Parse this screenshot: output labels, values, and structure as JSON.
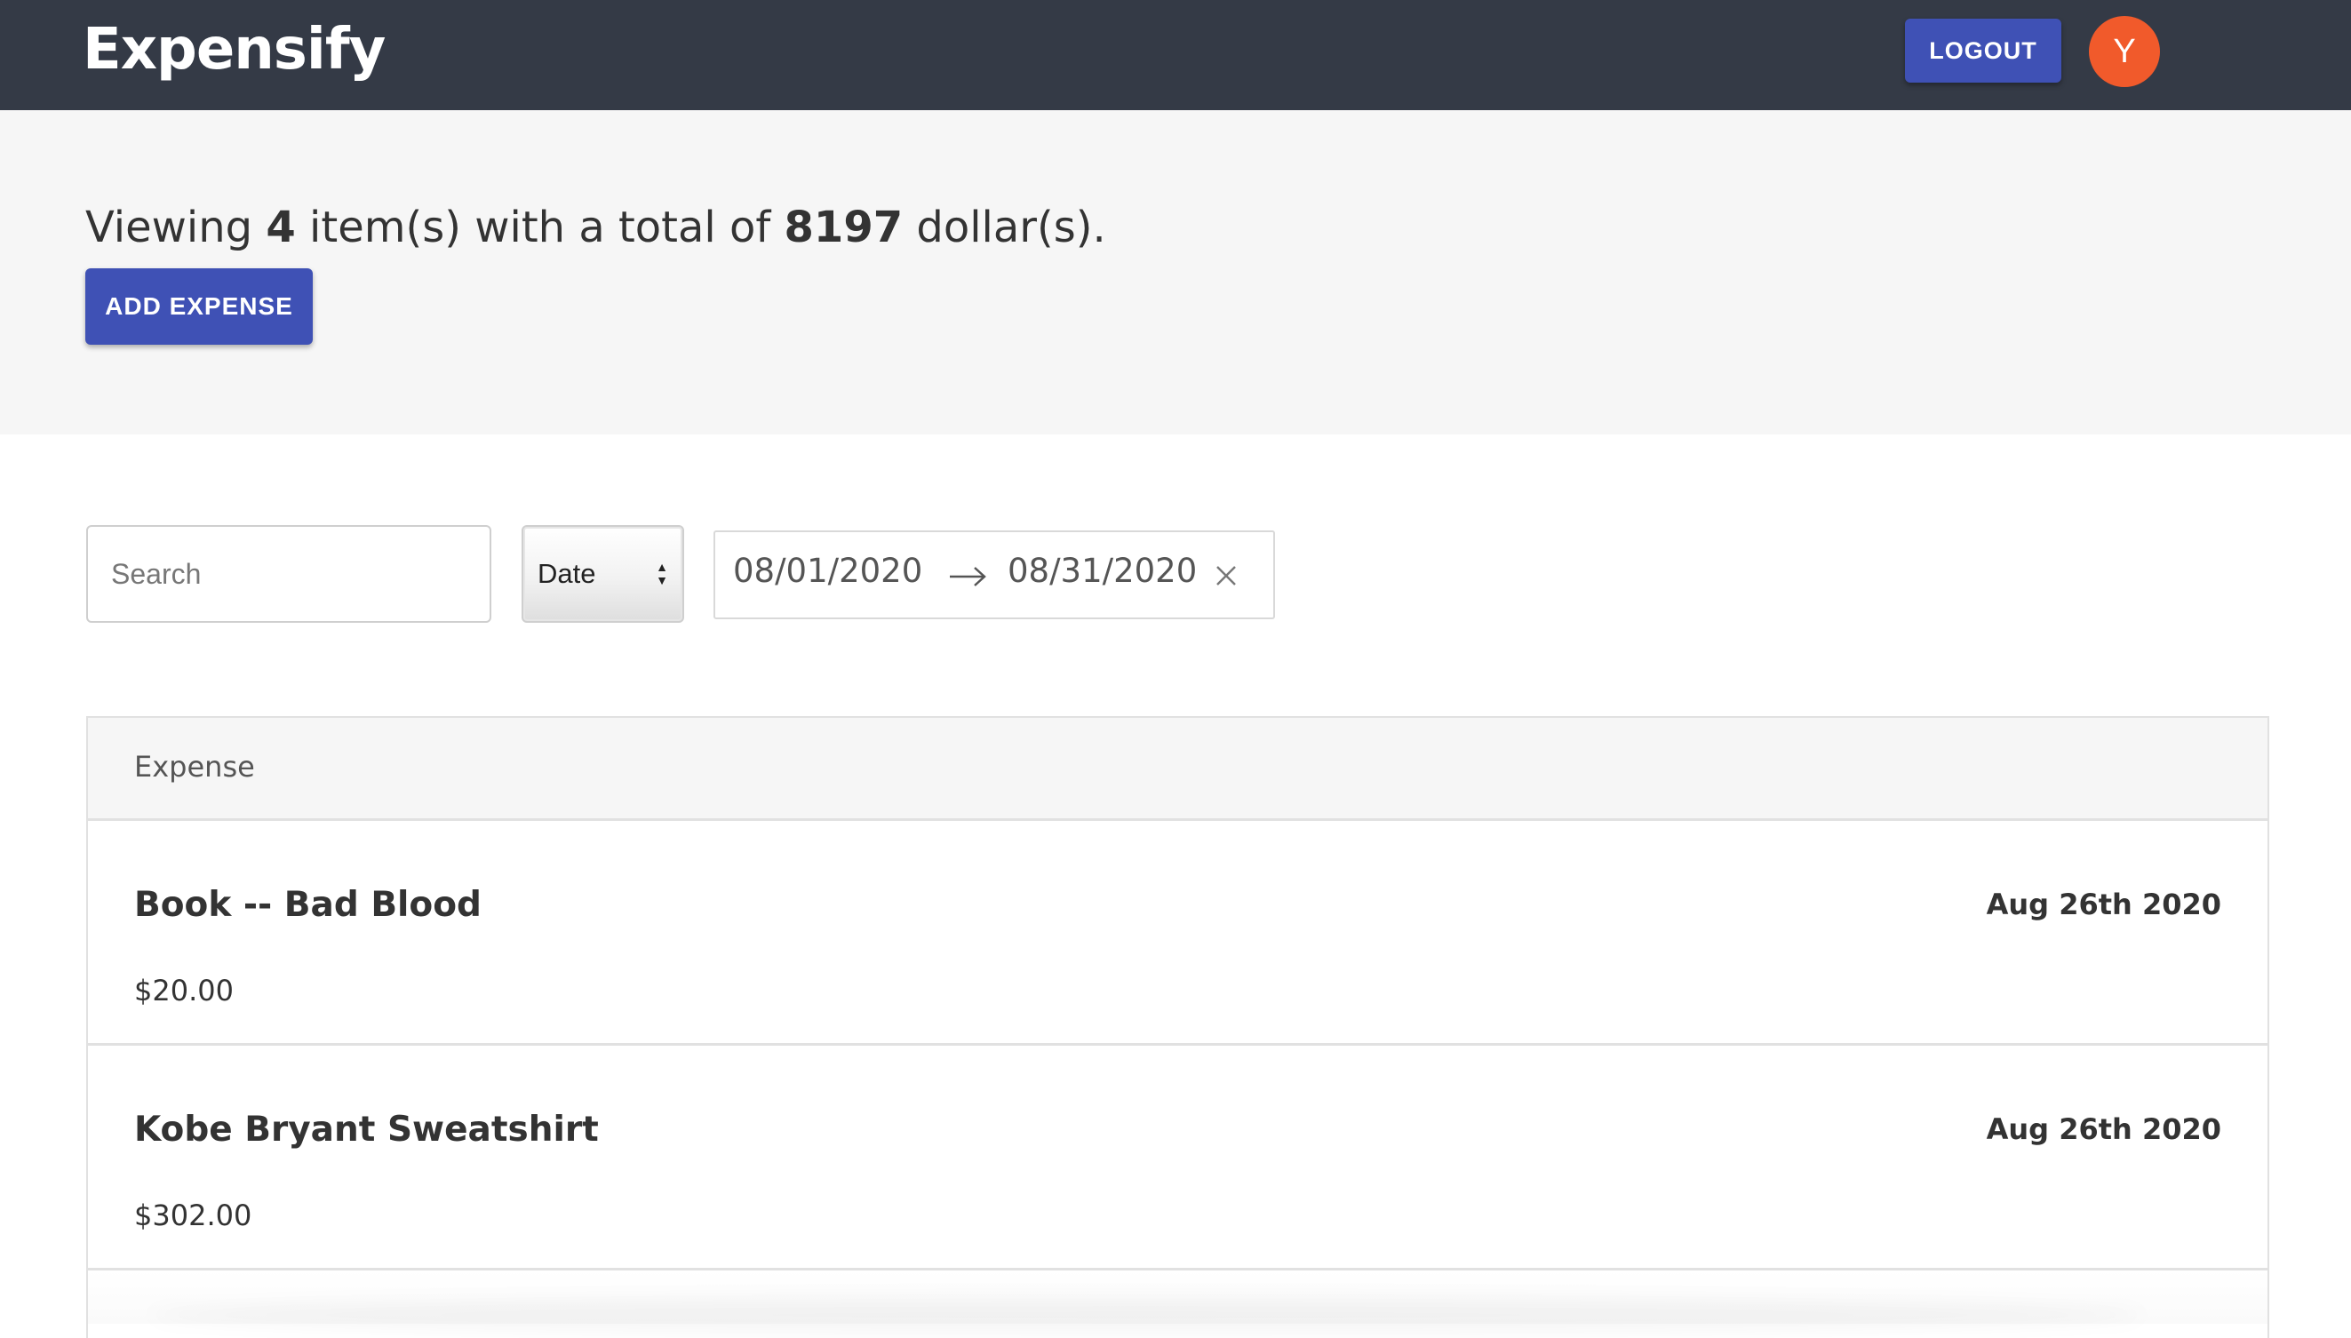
{
  "app": {
    "title": "Expensify"
  },
  "header": {
    "logout_label": "LOGOUT",
    "avatar_initial": "Y"
  },
  "summary": {
    "prefix": "Viewing ",
    "count": "4",
    "middle": " item(s) with a total of ",
    "total": "8197",
    "suffix": " dollar(s).",
    "add_label": "ADD EXPENSE"
  },
  "filters": {
    "search_placeholder": "Search",
    "search_value": "",
    "sort_selected": "Date",
    "date_start": "08/01/2020",
    "date_end": "08/31/2020"
  },
  "list": {
    "header": "Expense",
    "items": [
      {
        "description": "Book -- Bad Blood",
        "amount": "$20.00",
        "date": "Aug 26th 2020"
      },
      {
        "description": "Kobe Bryant Sweatshirt",
        "amount": "$302.00",
        "date": "Aug 26th 2020"
      }
    ]
  },
  "colors": {
    "header_bg": "#343a46",
    "accent": "#3f51b5",
    "avatar_bg": "#f15a2b",
    "summary_bg": "#f6f6f6"
  },
  "icons": {
    "range_arrow": "arrow-right-icon",
    "clear": "close-icon",
    "sort": "sort-arrows-icon"
  }
}
